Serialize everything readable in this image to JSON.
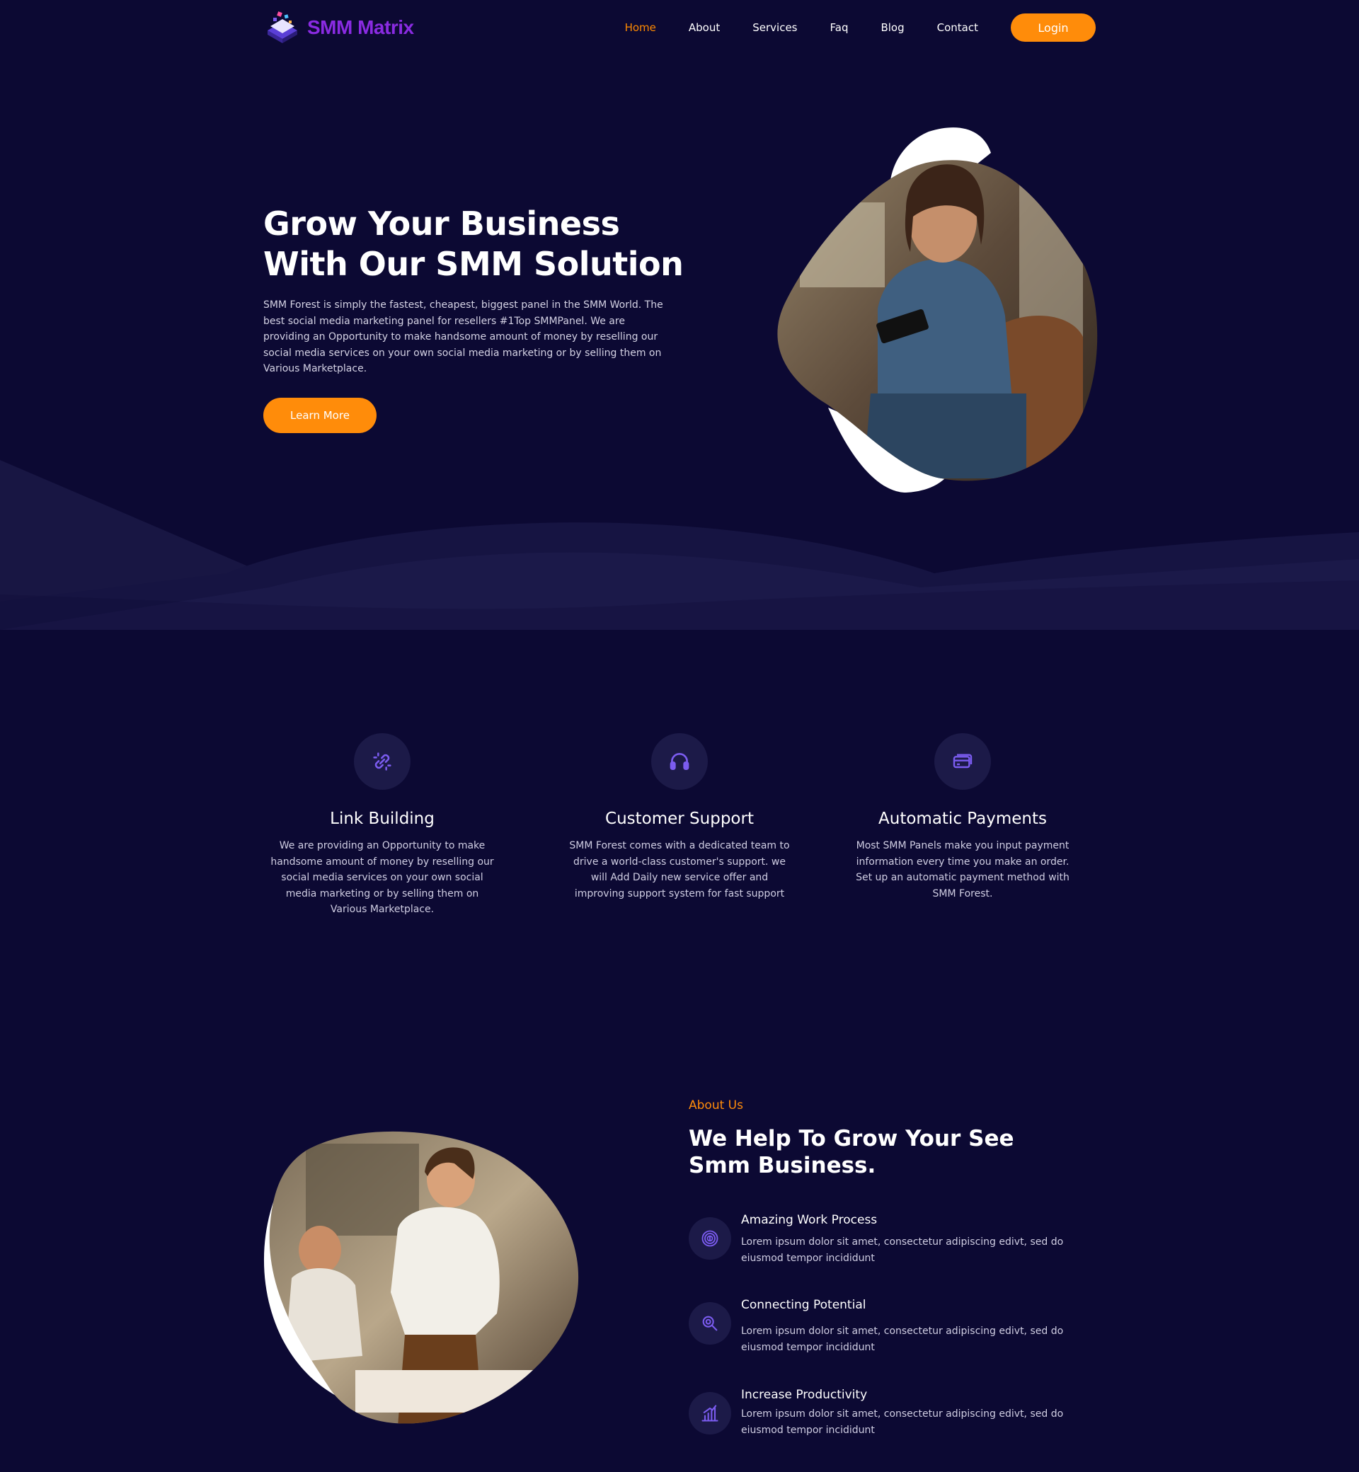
{
  "brand": {
    "name": "SMM Matrix",
    "logo_icon": "isometric-device-icon"
  },
  "nav": {
    "items": [
      {
        "label": "Home",
        "active": true
      },
      {
        "label": "About"
      },
      {
        "label": "Services"
      },
      {
        "label": "Faq"
      },
      {
        "label": "Blog"
      },
      {
        "label": "Contact"
      }
    ],
    "login_label": "Login"
  },
  "hero": {
    "title_line1": "Grow Your Business",
    "title_line2": "With Our SMM Solution",
    "text": "SMM Forest is simply the fastest, cheapest, biggest panel in the SMM World. The best social media marketing panel for resellers #1Top SMMPanel. We are providing an Opportunity to make handsome amount of money by reselling our social media services on your own social media marketing or by selling them on Various Marketplace.",
    "cta_label": "Learn More"
  },
  "features": [
    {
      "icon": "link-icon",
      "title": "Link Building",
      "text": "We are providing an Opportunity to make handsome amount of money by reselling our social media services on your own social media marketing or by selling them on Various Marketplace."
    },
    {
      "icon": "headphones-icon",
      "title": "Customer Support",
      "text": "SMM Forest comes with a dedicated team to drive a world-class customer's support. we will Add Daily new service offer and improving support system for fast support"
    },
    {
      "icon": "credit-card-icon",
      "title": "Automatic Payments",
      "text": "Most SMM Panels make you input payment information every time you make an order. Set up an automatic payment method with SMM Forest."
    }
  ],
  "about": {
    "kicker": "About Us",
    "title": "We Help To Grow Your See Smm Business.",
    "items": [
      {
        "icon": "fingerprint-icon",
        "title": "Amazing Work Process",
        "text": "Lorem ipsum dolor sit amet, consectetur adipiscing edivt, sed do eiusmod tempor incididunt"
      },
      {
        "icon": "search-icon",
        "title": "Connecting Potential",
        "text": "Lorem ipsum dolor sit amet, consectetur adipiscing edivt, sed do eiusmod tempor incididunt"
      },
      {
        "icon": "bar-chart-icon",
        "title": "Increase Productivity",
        "text": "Lorem ipsum dolor sit amet, consectetur adipiscing edivt, sed do eiusmod tempor incididunt"
      }
    ]
  },
  "colors": {
    "background": "#0c0933",
    "accent": "#ff8c0a",
    "brand": "#8a2be2",
    "icon_circle": "#1c1a48",
    "icon_stroke": "#7b5cf0"
  }
}
